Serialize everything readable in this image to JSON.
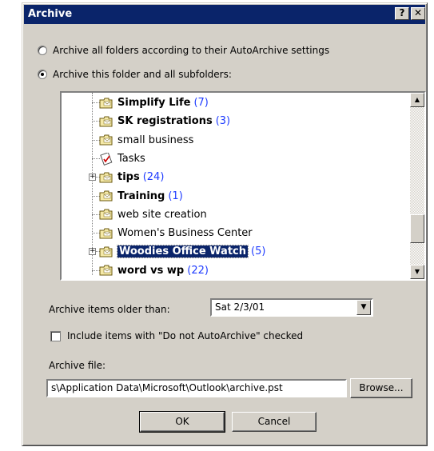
{
  "window": {
    "title": "Archive",
    "help_label": "?",
    "close_label": "✕"
  },
  "options": {
    "archive_all_label": "Archive all folders according to their AutoArchive settings",
    "archive_this_label": "Archive this folder and all subfolders:"
  },
  "tree": {
    "items": [
      {
        "name": "Simplify Life",
        "count": "(7)",
        "bold": true,
        "expander": ""
      },
      {
        "name": "SK registrations",
        "count": "(3)",
        "bold": true,
        "expander": ""
      },
      {
        "name": "small business",
        "count": "",
        "bold": false,
        "expander": ""
      },
      {
        "name": "Tasks",
        "count": "",
        "bold": false,
        "expander": "",
        "icon": "tasks-icon"
      },
      {
        "name": "tips",
        "count": "(24)",
        "bold": true,
        "expander": "+"
      },
      {
        "name": "Training",
        "count": "(1)",
        "bold": true,
        "expander": ""
      },
      {
        "name": "web site creation",
        "count": "",
        "bold": false,
        "expander": ""
      },
      {
        "name": "Women's Business Center",
        "count": "",
        "bold": false,
        "expander": ""
      },
      {
        "name": "Woodies Office Watch",
        "count": "(5)",
        "bold": true,
        "expander": "+",
        "selected": true
      },
      {
        "name": "word vs wp",
        "count": "(22)",
        "bold": true,
        "expander": ""
      }
    ]
  },
  "older_than": {
    "label": "Archive items older than:",
    "value": "Sat 2/3/01"
  },
  "include": {
    "label": "Include items with \"Do not AutoArchive\" checked"
  },
  "archive_file": {
    "label": "Archive file:",
    "value": "s\\Application Data\\Microsoft\\Outlook\\archive.pst",
    "browse_label": "Browse..."
  },
  "buttons": {
    "ok": "OK",
    "cancel": "Cancel"
  },
  "colors": {
    "titlebar": "#0a246a",
    "count": "#1f3cff",
    "face": "#d4d0c8"
  }
}
